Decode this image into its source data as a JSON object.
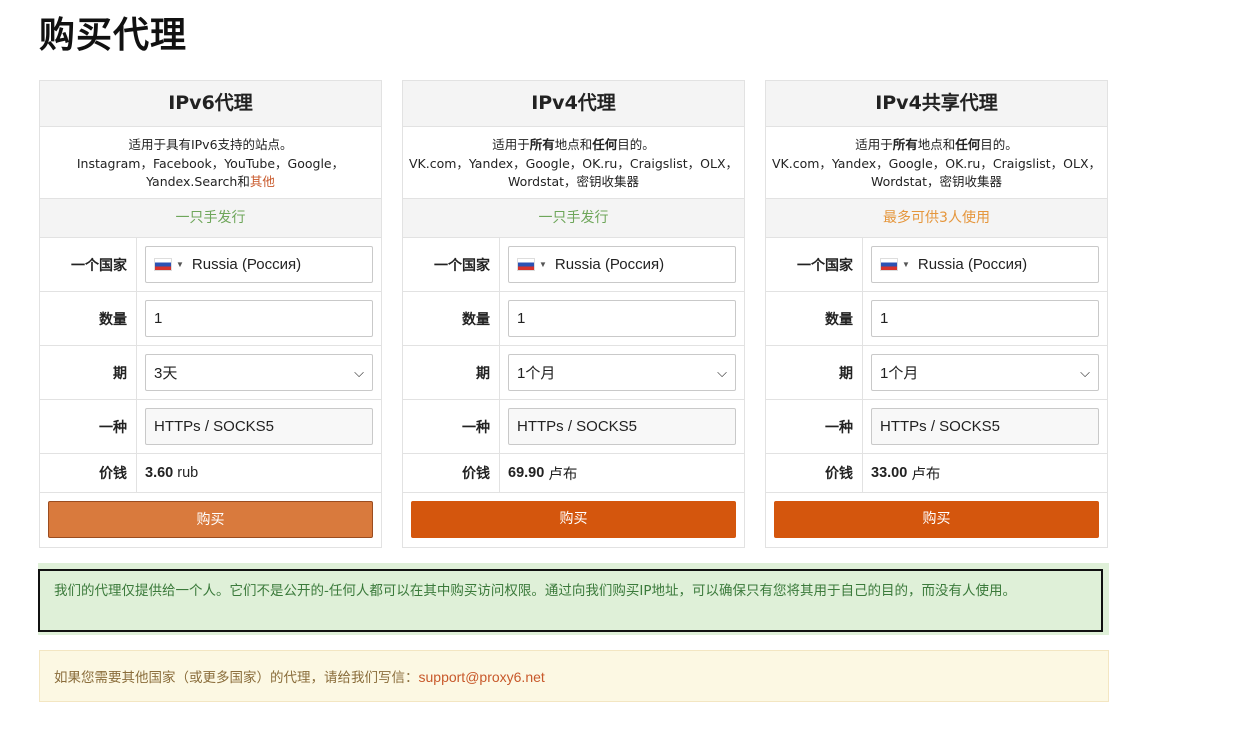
{
  "page_title": "购买代理",
  "cards": [
    {
      "title": "IPv6代理",
      "desc_line1_a": "适用于具有IPv6支持的站点。",
      "desc_line2": "Instagram，Facebook，YouTube，Google，",
      "desc_line3_a": "Yandex.Search和",
      "desc_line3_link": "其他",
      "tag": "一只手发行",
      "labels": {
        "country": "一个国家",
        "quantity": "数量",
        "period": "期",
        "type": "一种",
        "price": "价钱"
      },
      "country_value": "Russia (Россия)",
      "quantity_value": "1",
      "period_value": "3天",
      "type_value": "HTTPs / SOCKS5",
      "price_amount": "3.60",
      "price_unit": "rub",
      "buy_label": "购买"
    },
    {
      "title": "IPv4代理",
      "desc_pre": "适用于",
      "desc_b1": "所有",
      "desc_mid": "地点和",
      "desc_b2": "任何",
      "desc_post": "目的。",
      "desc_line2": "VK.com，Yandex，Google，OK.ru，Craigslist，OLX，",
      "desc_line3": "Wordstat，密钥收集器",
      "tag": "一只手发行",
      "labels": {
        "country": "一个国家",
        "quantity": "数量",
        "period": "期",
        "type": "一种",
        "price": "价钱"
      },
      "country_value": "Russia (Россия)",
      "quantity_value": "1",
      "period_value": "1个月",
      "type_value": "HTTPs / SOCKS5",
      "price_amount": "69.90",
      "price_unit": "卢布",
      "buy_label": "购买"
    },
    {
      "title": "IPv4共享代理",
      "desc_pre": "适用于",
      "desc_b1": "所有",
      "desc_mid": "地点和",
      "desc_b2": "任何",
      "desc_post": "目的。",
      "desc_line2": "VK.com，Yandex，Google，OK.ru，Craigslist，OLX，",
      "desc_line3": "Wordstat，密钥收集器",
      "tag": "最多可供3人使用",
      "labels": {
        "country": "一个国家",
        "quantity": "数量",
        "period": "期",
        "type": "一种",
        "price": "价钱"
      },
      "country_value": "Russia (Россия)",
      "quantity_value": "1",
      "period_value": "1个月",
      "type_value": "HTTPs / SOCKS5",
      "price_amount": "33.00",
      "price_unit": "卢布",
      "buy_label": "购买"
    }
  ],
  "notice_private": "我们的代理仅提供给一个人。它们不是公开的-任何人都可以在其中购买访问权限。通过向我们购买IP地址，可以确保只有您将其用于自己的目的，而没有人使用。",
  "notice_contact_text": "如果您需要其他国家（或更多国家）的代理，请给我们写信：",
  "notice_contact_email": "support@proxy6.net",
  "icons": {
    "flag": "russia-flag-icon",
    "dropdown": "chevron-down-icon"
  },
  "colors": {
    "buy_button": "#d4560d",
    "buy_button_hover": "#d97a3d",
    "tag_green": "#6ea65a",
    "tag_orange": "#e5963c",
    "link": "#c8592b"
  }
}
